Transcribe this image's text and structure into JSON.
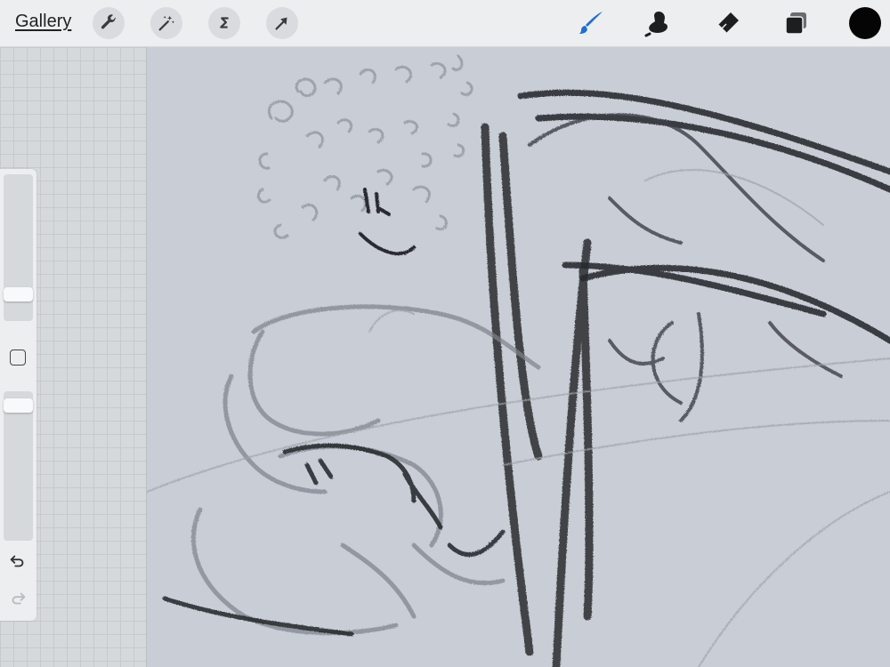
{
  "toolbar": {
    "gallery_label": "Gallery",
    "left_tools": [
      {
        "icon": "wrench-icon",
        "name": "actions"
      },
      {
        "icon": "magic-wand-icon",
        "name": "adjustments"
      },
      {
        "icon": "selection-s-icon",
        "name": "selection"
      },
      {
        "icon": "arrow-cursor-icon",
        "name": "transform"
      }
    ],
    "right_tools": [
      {
        "icon": "brush-icon",
        "name": "paint",
        "active": true
      },
      {
        "icon": "smudge-icon",
        "name": "smudge"
      },
      {
        "icon": "eraser-icon",
        "name": "erase"
      },
      {
        "icon": "layers-icon",
        "name": "layers"
      }
    ],
    "current_color": "#050505",
    "active_accent": "#1f6fd1"
  },
  "sidebar": {
    "brush_size_level": 0.15,
    "opacity_level": 0.95,
    "modify_icon": "square-icon",
    "undo_icon": "undo-arrow-icon",
    "redo_icon": "redo-arrow-icon"
  },
  "canvas": {
    "background": "#c9cdd6",
    "stroke_color": "#2a2c30"
  }
}
